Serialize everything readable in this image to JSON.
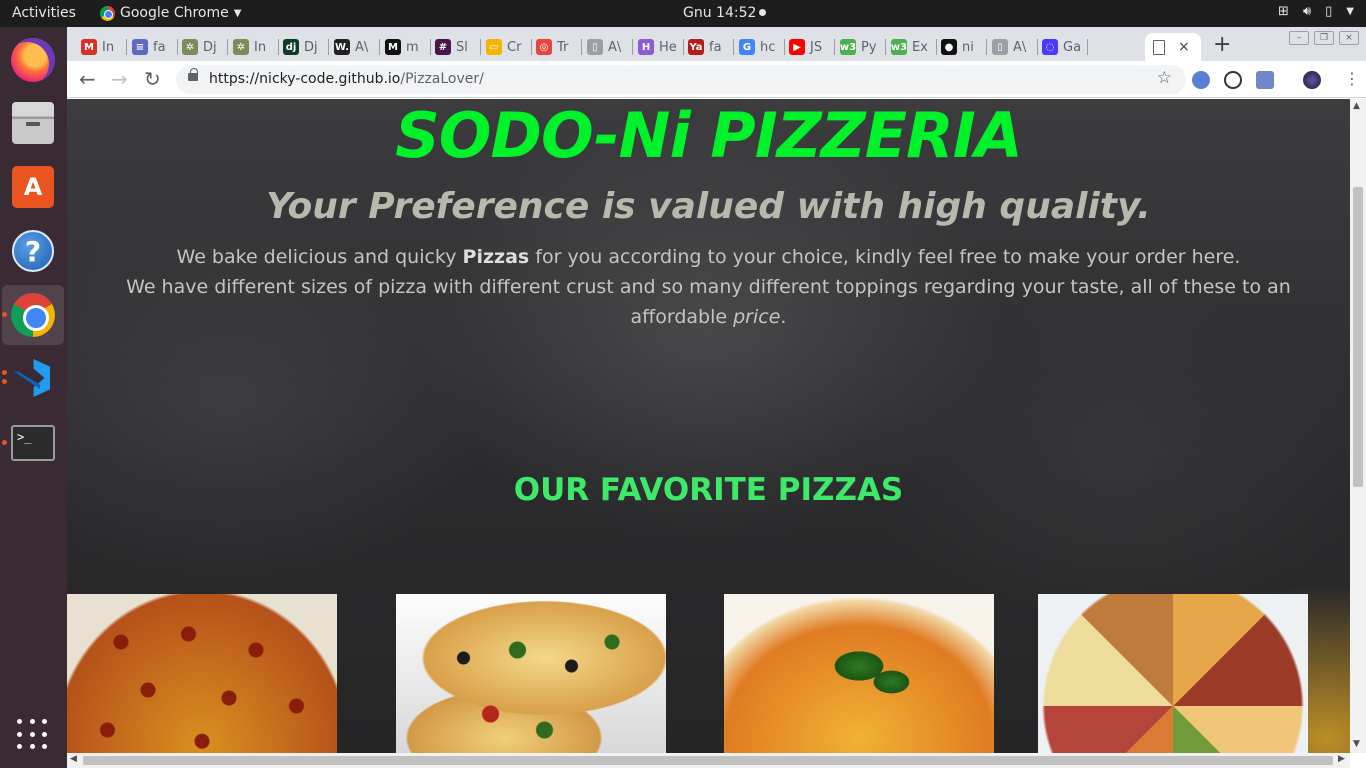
{
  "system_bar": {
    "activities": "Activities",
    "app_name": "Google Chrome",
    "clock": "Gnu 14:52"
  },
  "dock": {
    "items": [
      "Firefox",
      "Files",
      "Ubuntu Software",
      "Help",
      "Google Chrome",
      "Visual Studio Code",
      "Terminal",
      "Show Applications"
    ]
  },
  "browser": {
    "tabs": [
      {
        "label": "In",
        "icon": "gmail-icon",
        "color": "#d93025",
        "glyph": "M"
      },
      {
        "label": "fa",
        "icon": "docs-icon",
        "color": "#5c6bc0",
        "glyph": "≡"
      },
      {
        "label": "Dj",
        "icon": "palm-icon",
        "color": "#7b8b5a",
        "glyph": "✲"
      },
      {
        "label": "In",
        "icon": "palm-icon",
        "color": "#7b8b5a",
        "glyph": "✲"
      },
      {
        "label": "Dj",
        "icon": "django-icon",
        "color": "#0c3c26",
        "glyph": "dj"
      },
      {
        "label": "A\\",
        "icon": "w-icon",
        "color": "#222222",
        "glyph": "W."
      },
      {
        "label": "m",
        "icon": "medium-icon",
        "color": "#111111",
        "glyph": "M"
      },
      {
        "label": "Sl",
        "icon": "slack-icon",
        "color": "#4a154b",
        "glyph": "#"
      },
      {
        "label": "Cr",
        "icon": "slides-icon",
        "color": "#f4b400",
        "glyph": "▭"
      },
      {
        "label": "Tr",
        "icon": "spiral-icon",
        "color": "#e8453c",
        "glyph": "◎"
      },
      {
        "label": "A\\",
        "icon": "page-icon",
        "color": "#9aa0a6",
        "glyph": "▯"
      },
      {
        "label": "He",
        "icon": "heroku-icon",
        "color": "#8e5bd6",
        "glyph": "H"
      },
      {
        "label": "fa",
        "icon": "ya-icon",
        "color": "#b71c1c",
        "glyph": "Ya"
      },
      {
        "label": "hc",
        "icon": "google-icon",
        "color": "#4285f4",
        "glyph": "G"
      },
      {
        "label": "JS",
        "icon": "youtube-icon",
        "color": "#ff0000",
        "glyph": "▶"
      },
      {
        "label": "Py",
        "icon": "w3-icon",
        "color": "#4caf50",
        "glyph": "w3"
      },
      {
        "label": "Ex",
        "icon": "w3-icon",
        "color": "#4caf50",
        "glyph": "w3"
      },
      {
        "label": "ni",
        "icon": "github-icon",
        "color": "#111111",
        "glyph": "●"
      },
      {
        "label": "A\\",
        "icon": "page-icon",
        "color": "#9aa0a6",
        "glyph": "▯"
      },
      {
        "label": "Ga",
        "icon": "loading-icon",
        "color": "#4a3aff",
        "glyph": "◌"
      }
    ],
    "active_tab_close": "×",
    "new_tab": "+",
    "url_host": "https://nicky-code.github.io",
    "url_path": "/PizzaLover/"
  },
  "page": {
    "title": "SODO-Ni PIZZERIA",
    "tagline": "Your Preference is valued with high quality.",
    "intro_part1": "We bake delicious and quicky ",
    "intro_bold": "Pizzas",
    "intro_part2": " for you according to your choice, kindly feel free to make your order here.",
    "intro_line2": "We have different sizes of pizza with different crust and so many different toppings regarding your taste, all of these to an affordable ",
    "intro_italic": "price",
    "intro_end": ".",
    "section_title": "OUR FAVORITE PIZZAS",
    "pizzas": [
      "pepperoni-pizza-image",
      "veggie-pizza-image",
      "margherita-pizza-image",
      "mixed-pizza-image"
    ]
  },
  "colors": {
    "title": "#00f22a",
    "section_title": "#3ee96a",
    "tagline": "#b7b9ad"
  }
}
